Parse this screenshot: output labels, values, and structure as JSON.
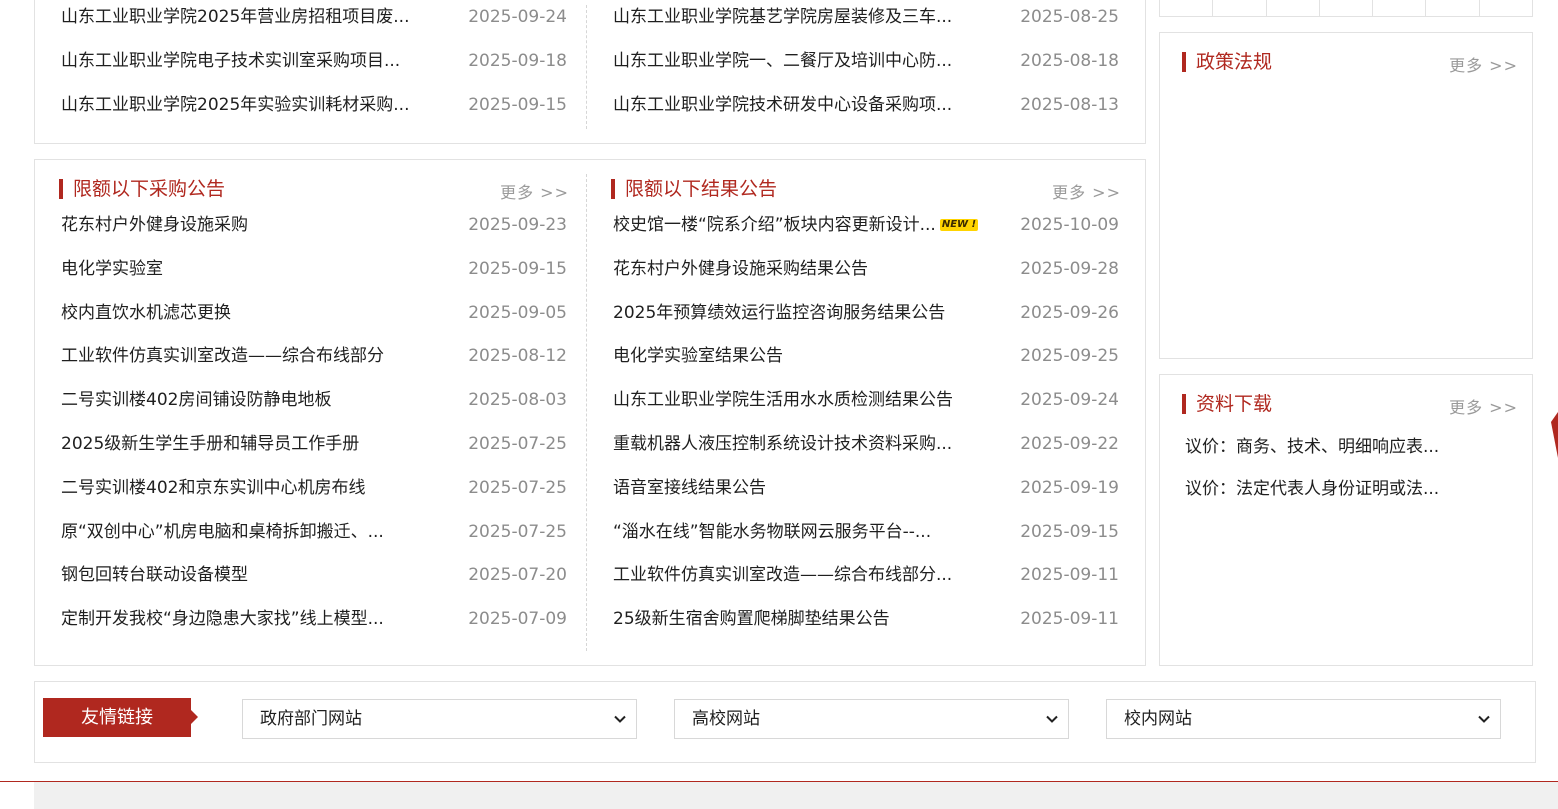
{
  "top_section": {
    "left_items": [
      {
        "title": "山东工业职业学院2025年营业房招租项目废...",
        "date": "2025-09-24"
      },
      {
        "title": "山东工业职业学院电子技术实训室采购项目...",
        "date": "2025-09-18"
      },
      {
        "title": "山东工业职业学院2025年实验实训耗材采购...",
        "date": "2025-09-15"
      }
    ],
    "right_items": [
      {
        "title": "山东工业职业学院基艺学院房屋装修及三车...",
        "date": "2025-08-25"
      },
      {
        "title": "山东工业职业学院一、二餐厅及培训中心防...",
        "date": "2025-08-18"
      },
      {
        "title": "山东工业职业学院技术研发中心设备采购项...",
        "date": "2025-08-13"
      }
    ]
  },
  "procurement": {
    "title": "限额以下采购公告",
    "more": "更多 >>",
    "items": [
      {
        "title": "花东村户外健身设施采购",
        "date": "2025-09-23"
      },
      {
        "title": "电化学实验室",
        "date": "2025-09-15"
      },
      {
        "title": "校内直饮水机滤芯更换",
        "date": "2025-09-05"
      },
      {
        "title": "工业软件仿真实训室改造——综合布线部分",
        "date": "2025-08-12"
      },
      {
        "title": "二号实训楼402房间铺设防静电地板",
        "date": "2025-08-03"
      },
      {
        "title": "2025级新生学生手册和辅导员工作手册",
        "date": "2025-07-25"
      },
      {
        "title": "二号实训楼402和京东实训中心机房布线",
        "date": "2025-07-25"
      },
      {
        "title": "原“双创中心”机房电脑和桌椅拆卸搬迁、...",
        "date": "2025-07-25"
      },
      {
        "title": "钢包回转台联动设备模型",
        "date": "2025-07-20"
      },
      {
        "title": "定制开发我校“身边隐患大家找”线上模型...",
        "date": "2025-07-09"
      }
    ]
  },
  "results": {
    "title": "限额以下结果公告",
    "more": "更多 >>",
    "new_badge": "NEW !",
    "items": [
      {
        "title": "校史馆一楼“院系介绍”板块内容更新设计...",
        "date": "2025-10-09"
      },
      {
        "title": "花东村户外健身设施采购结果公告",
        "date": "2025-09-28"
      },
      {
        "title": "2025年预算绩效运行监控咨询服务结果公告",
        "date": "2025-09-26"
      },
      {
        "title": "电化学实验室结果公告",
        "date": "2025-09-25"
      },
      {
        "title": "山东工业职业学院生活用水水质检测结果公告",
        "date": "2025-09-24"
      },
      {
        "title": "重载机器人液压控制系统设计技术资料采购...",
        "date": "2025-09-22"
      },
      {
        "title": "语音室接线结果公告",
        "date": "2025-09-19"
      },
      {
        "title": "“淄水在线”智能水务物联网云服务平台--...",
        "date": "2025-09-15"
      },
      {
        "title": "工业软件仿真实训室改造——综合布线部分...",
        "date": "2025-09-11"
      },
      {
        "title": "25级新生宿舍购置爬梯脚垫结果公告",
        "date": "2025-09-11"
      }
    ]
  },
  "policy": {
    "title": "政策法规",
    "more": "更多 >>"
  },
  "downloads": {
    "title": "资料下载",
    "more": "更多 >>",
    "items": [
      "议价：商务、技术、明细响应表...",
      "议价：法定代表人身份证明或法..."
    ]
  },
  "links": {
    "tab_label": "友情链接",
    "selects": [
      "政府部门网站",
      "高校网站",
      "校内网站"
    ]
  },
  "colors": {
    "accent": "#b0281f",
    "date_gray": "#8c8c8c",
    "new_badge": "#ffd400"
  }
}
